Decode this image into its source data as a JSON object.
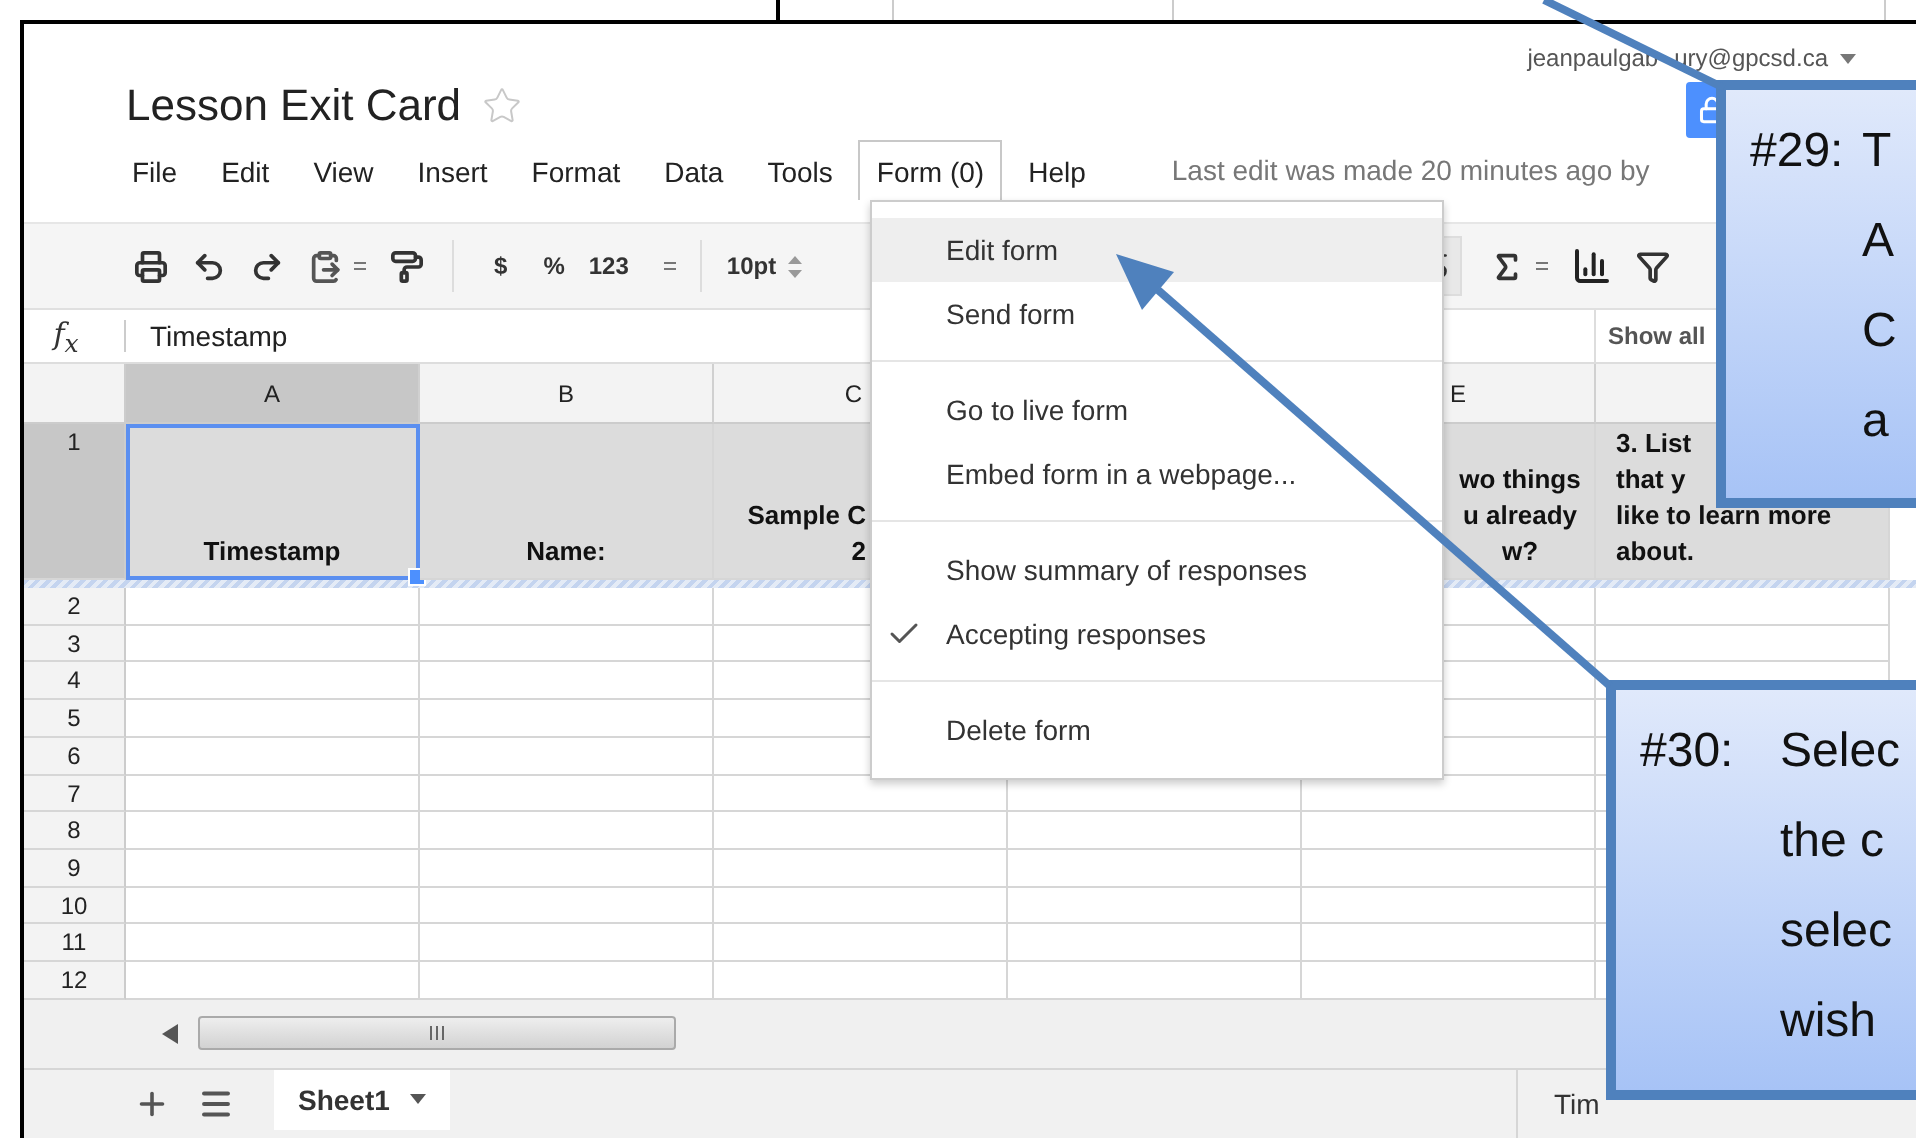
{
  "account": {
    "email_start": "jeanpaulgab",
    "email_end": "ury@gpcsd.ca"
  },
  "document": {
    "title": "Lesson Exit Card",
    "starred": false
  },
  "menu_bar": [
    {
      "label": "File",
      "selected": false
    },
    {
      "label": "Edit",
      "selected": false
    },
    {
      "label": "View",
      "selected": false
    },
    {
      "label": "Insert",
      "selected": false
    },
    {
      "label": "Format",
      "selected": false
    },
    {
      "label": "Data",
      "selected": false
    },
    {
      "label": "Tools",
      "selected": false
    },
    {
      "label": "Form (0)",
      "selected": true
    },
    {
      "label": "Help",
      "selected": false
    }
  ],
  "last_edit": "Last edit was made 20 minutes ago by",
  "toolbar": {
    "currency": "$",
    "percent": "%",
    "number_format": "123",
    "font_size": "10pt"
  },
  "formula_bar": {
    "function_label": "f$_{x}$",
    "value": "Timestamp",
    "show_all": "Show all"
  },
  "columns": [
    {
      "label": "A",
      "selected": true
    },
    {
      "label": "B",
      "selected": false
    },
    {
      "label": "C",
      "selected": false
    },
    {},
    {
      "label": "E",
      "selected": false
    },
    {
      "selected": false
    }
  ],
  "rows": [
    {
      "number": "1",
      "selected": true,
      "cells": [
        [
          "Timestamp"
        ],
        [
          "Name:"
        ],
        [
          "Sample C",
          "2"
        ],
        [],
        [
          "wo things",
          "u already",
          "w?"
        ],
        [
          "3. List",
          "that y",
          "like to learn more",
          "about."
        ]
      ]
    },
    {
      "number": "2",
      "selected": false
    },
    {
      "number": "3",
      "selected": false
    },
    {
      "number": "4",
      "selected": false
    },
    {
      "number": "5",
      "selected": false
    },
    {
      "number": "6",
      "selected": false
    },
    {
      "number": "7",
      "selected": false
    },
    {
      "number": "8",
      "selected": false
    },
    {
      "number": "9",
      "selected": false
    },
    {
      "number": "10",
      "selected": false
    },
    {
      "number": "11",
      "selected": false
    },
    {
      "number": "12",
      "selected": false
    }
  ],
  "sheet_tabs": [
    {
      "label": "Sheet1",
      "selected": true
    }
  ],
  "status_bar": "Tim",
  "form_menu": [
    {
      "kind": "item",
      "label": "Edit form",
      "highlighted": true,
      "checked": false
    },
    {
      "kind": "item",
      "label": "Send form",
      "highlighted": false,
      "checked": false
    },
    {
      "kind": "separator"
    },
    {
      "kind": "item",
      "label": "Go to live form",
      "highlighted": false,
      "checked": false
    },
    {
      "kind": "item",
      "label": "Embed form in a webpage...",
      "highlighted": false,
      "checked": false
    },
    {
      "kind": "separator"
    },
    {
      "kind": "item",
      "label": "Show summary of responses",
      "highlighted": false,
      "checked": false
    },
    {
      "kind": "item",
      "label": "Accepting responses",
      "highlighted": false,
      "checked": true
    },
    {
      "kind": "separator"
    },
    {
      "kind": "item",
      "label": "Delete form",
      "highlighted": false,
      "checked": false
    }
  ],
  "callouts": [
    {
      "number": "#29:",
      "lines": [
        "T",
        "A",
        "C",
        "a"
      ]
    },
    {
      "number": "#30:",
      "lines": [
        "Selec",
        "the c",
        "selec",
        "wish"
      ]
    }
  ]
}
